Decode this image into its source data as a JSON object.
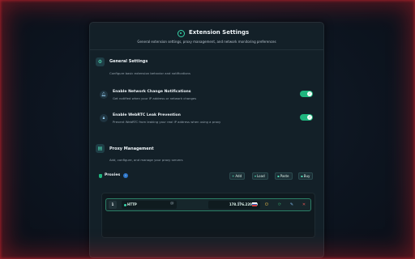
{
  "header": {
    "title": "Extension Settings",
    "subtitle": "General extension settings, proxy management, and network monitoring preferences"
  },
  "general": {
    "title": "General Settings",
    "description": "Configure basic extension behavior and notifications",
    "items": [
      {
        "title": "Enable Network Change Notifications",
        "description": "Get notified when your IP address or network changes",
        "enabled": true
      },
      {
        "title": "Enable WebRTC Leak Prevention",
        "description": "Prevent WebRTC from leaking your real IP address when using a proxy",
        "enabled": true
      }
    ]
  },
  "proxy": {
    "title": "Proxy Management",
    "description": "Add, configure, and manage your proxy servers",
    "list_label": "Proxies",
    "info_badge": "i",
    "buttons": {
      "add": "Add",
      "load": "Load",
      "paste": "Paste",
      "buy": "Buy"
    },
    "rows": [
      {
        "index": "1",
        "type": "HTTP",
        "address": "178.176.220.60"
      }
    ]
  },
  "colors": {
    "accent": "#36d3a8",
    "toggle_on": "#1fb57e",
    "border_glow": "#c81e28"
  },
  "icons": [
    "shield-logo-icon",
    "gear-icon",
    "bell-icon",
    "lock-icon",
    "server-icon",
    "info-icon",
    "plus-icon",
    "download-icon",
    "paste-icon",
    "cart-icon",
    "power-icon",
    "refresh-icon",
    "edit-icon",
    "close-icon",
    "flag-icon"
  ]
}
